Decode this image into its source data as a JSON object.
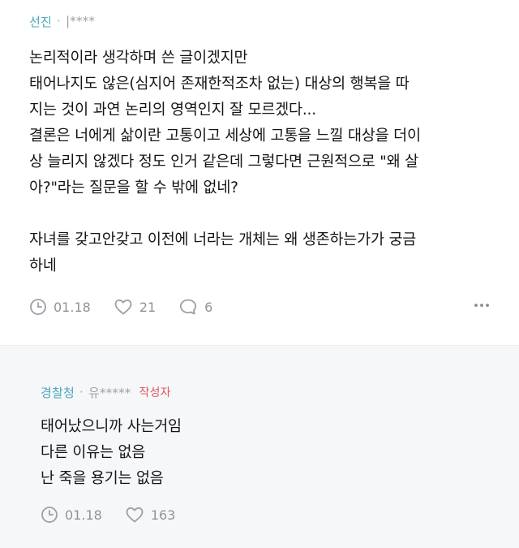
{
  "main_comment": {
    "author": "선진",
    "separator": "·",
    "user_id": "|****",
    "lines": [
      "논리적이라 생각하며 쓴 글이겠지만",
      "태어나지도 않은(심지어 존재한적조차 없는) 대상의 행복을 따",
      "지는 것이 과연 논리의 영역인지 잘 모르겠다...",
      "결론은 너에게 삶이란 고통이고 세상에 고통을 느낄 대상을 더이",
      "상 늘리지 않겠다 정도 인거 같은데 그렇다면 근원적으로 \"왜 살",
      "아?\"라는 질문을 할 수 밖에 없네?",
      "",
      "자녀를 갖고안갖고 이전에 너라는 개체는 왜 생존하는가가 궁금",
      "하네"
    ],
    "date": "01.18",
    "likes": "21",
    "replies": "6",
    "icons": {
      "date": "clock-icon",
      "likes": "heart-icon",
      "replies": "speech-bubble-icon",
      "more": "more-options-icon"
    }
  },
  "reply_comment": {
    "author": "경찰청",
    "separator": "·",
    "user_id": "유*****",
    "badge": "작성자",
    "lines": [
      "태어났으니까 사는거임",
      "다른 이유는 없음",
      "난 죽을 용기는 없음"
    ],
    "date": "01.18",
    "likes": "163",
    "icons": {
      "date": "clock-icon",
      "likes": "heart-icon"
    }
  },
  "colors": {
    "author": "#4aa6b8",
    "meta_gray": "#9ba0a6",
    "badge_red": "#e0585f",
    "text": "#151515",
    "reply_background": "#f6f7f9"
  }
}
